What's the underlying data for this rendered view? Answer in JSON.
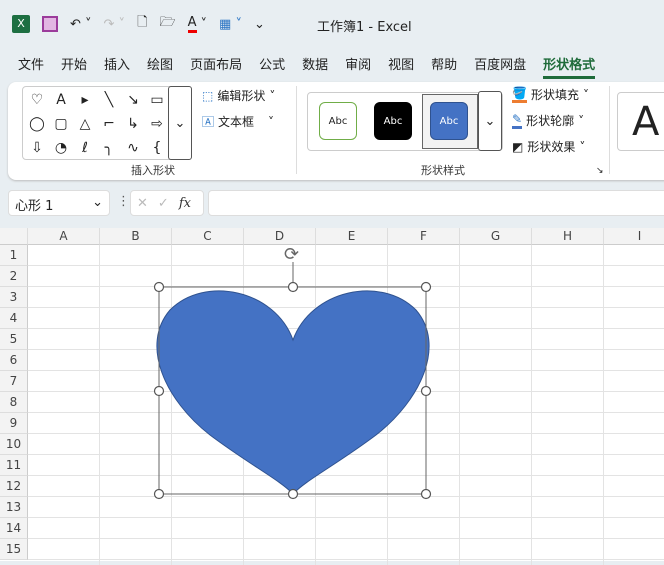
{
  "window": {
    "title": "工作簿1  -  Excel"
  },
  "qat": {
    "customize": "⌄"
  },
  "tabs": [
    {
      "label": "文件"
    },
    {
      "label": "开始"
    },
    {
      "label": "插入"
    },
    {
      "label": "绘图"
    },
    {
      "label": "页面布局"
    },
    {
      "label": "公式"
    },
    {
      "label": "数据"
    },
    {
      "label": "审阅"
    },
    {
      "label": "视图"
    },
    {
      "label": "帮助"
    },
    {
      "label": "百度网盘"
    },
    {
      "label": "形状格式",
      "active": true
    }
  ],
  "ribbon": {
    "insert_shapes": {
      "label": "插入形状",
      "shapes": [
        "♡",
        "A",
        "▸",
        "╲",
        "↘",
        "▭",
        "◯",
        "▢",
        "△",
        "⌐",
        "↳",
        "⇨",
        "⇩",
        "◔",
        "ℓ",
        "╮",
        "∿",
        "{"
      ],
      "edit_shape": "编辑形状",
      "text_box": "文本框"
    },
    "shape_styles": {
      "label": "形状样式",
      "swatches": [
        {
          "text": "Abc",
          "bg": "#ffffff",
          "border": "#70ad47",
          "color": "#222"
        },
        {
          "text": "Abc",
          "bg": "#000000",
          "border": "#000",
          "color": "#fff"
        },
        {
          "text": "Abc",
          "bg": "#4472c4",
          "border": "#2f528f",
          "color": "#fff"
        }
      ],
      "fill": "形状填充",
      "outline": "形状轮廓",
      "effects": "形状效果"
    },
    "wordart_preview": "A"
  },
  "formula_bar": {
    "name_box": "心形 1",
    "fx": "fx",
    "cancel": "✕",
    "enter": "✓",
    "value": ""
  },
  "sheet": {
    "columns": [
      "A",
      "B",
      "C",
      "D",
      "E",
      "F",
      "G",
      "H",
      "I"
    ],
    "rows": [
      "1",
      "2",
      "3",
      "4",
      "5",
      "6",
      "7",
      "8",
      "9",
      "10",
      "11",
      "12",
      "13",
      "14",
      "15"
    ]
  },
  "shape": {
    "type": "heart",
    "fill": "#4472c4",
    "stroke": "#2f528f"
  }
}
